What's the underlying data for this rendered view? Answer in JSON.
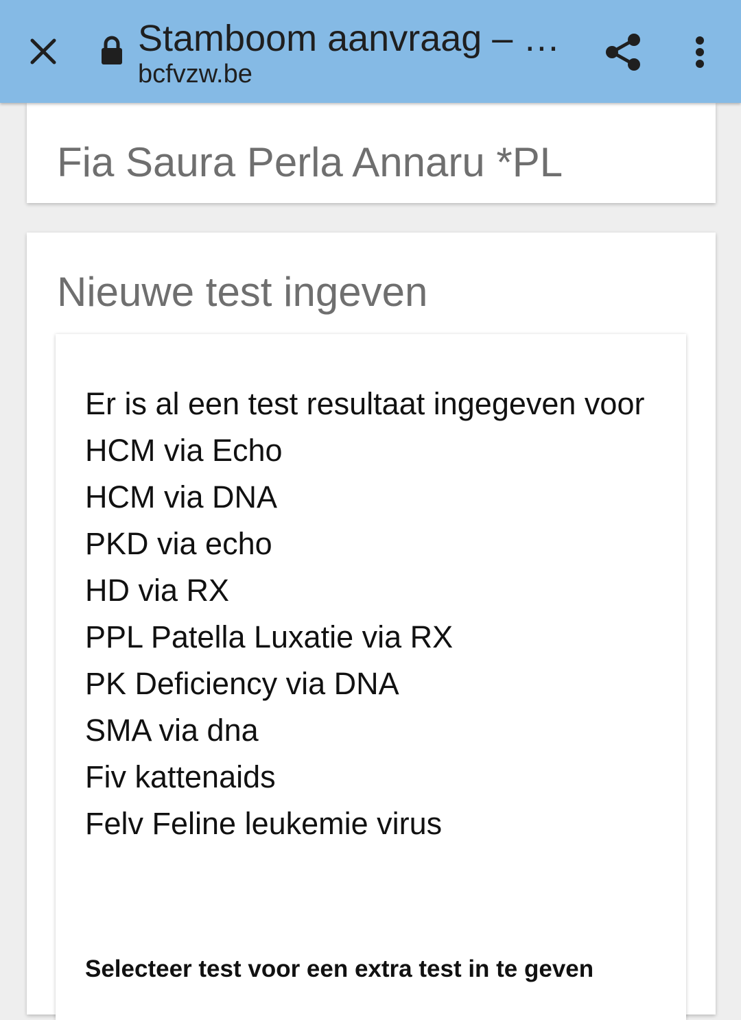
{
  "browser": {
    "title": "Stamboom aanvraag – …",
    "url": "bcfvzw.be",
    "icons": {
      "close": "close-icon",
      "lock": "lock-icon",
      "share": "share-icon",
      "menu": "more-vert-icon"
    },
    "bar_color": "#85bae5"
  },
  "cat": {
    "name": "Fia Saura Perla Annaru *PL"
  },
  "test_section": {
    "title": "Nieuwe test ingeven",
    "notice": "Er is al een test resultaat ingegeven voor",
    "existing_tests": [
      "HCM via Echo",
      "HCM via DNA",
      "PKD via echo",
      "HD via RX",
      "PPL Patella Luxatie via RX",
      "PK Deficiency via DNA",
      "SMA via dna",
      "Fiv kattenaids",
      "Felv Feline leukemie virus"
    ],
    "select_label": "Selecteer test voor een extra test in te geven"
  }
}
